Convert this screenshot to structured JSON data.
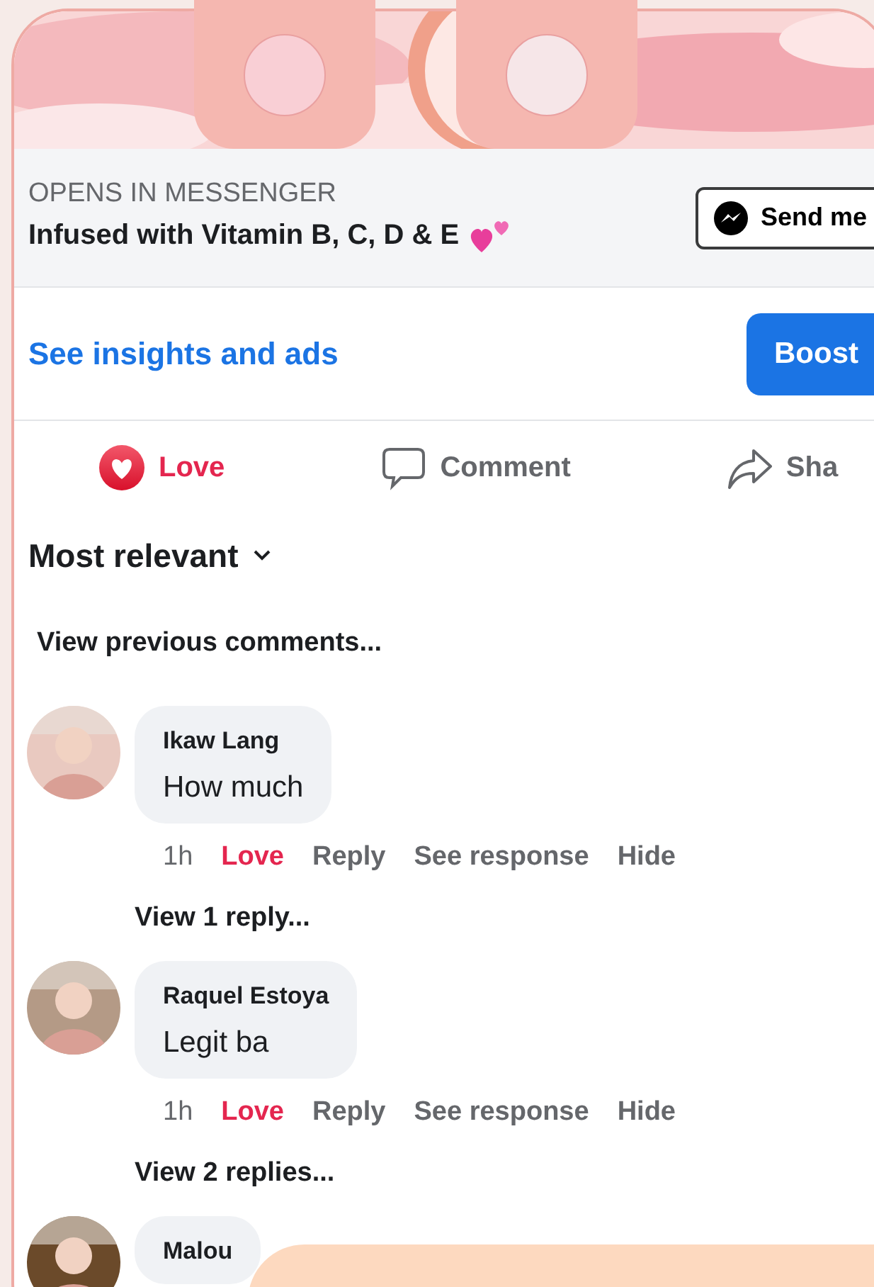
{
  "cta": {
    "caption": "OPENS IN MESSENGER",
    "headline": "Infused with Vitamin B, C, D & E",
    "button": "Send me"
  },
  "insights": {
    "link": "See insights and ads",
    "button": "Boost"
  },
  "actions": [
    {
      "label": "Love",
      "kind": "love",
      "selected": true
    },
    {
      "label": "Comment",
      "kind": "comment",
      "selected": false
    },
    {
      "label": "Sha",
      "kind": "share",
      "selected": false
    }
  ],
  "sort": {
    "label": "Most relevant"
  },
  "previous": "View previous comments...",
  "comments": [
    {
      "author": "Ikaw Lang",
      "text": "How much",
      "time": "1h",
      "reaction": "Love",
      "reacted": true,
      "actions": [
        "Reply",
        "See response",
        "Hide"
      ],
      "replies": "View 1 reply..."
    },
    {
      "author": "Raquel Estoya",
      "text": "Legit ba",
      "time": "1h",
      "reaction": "Love",
      "reacted": true,
      "actions": [
        "Reply",
        "See response",
        "Hide"
      ],
      "replies": "View 2 replies..."
    },
    {
      "author": "Malou"
    }
  ]
}
